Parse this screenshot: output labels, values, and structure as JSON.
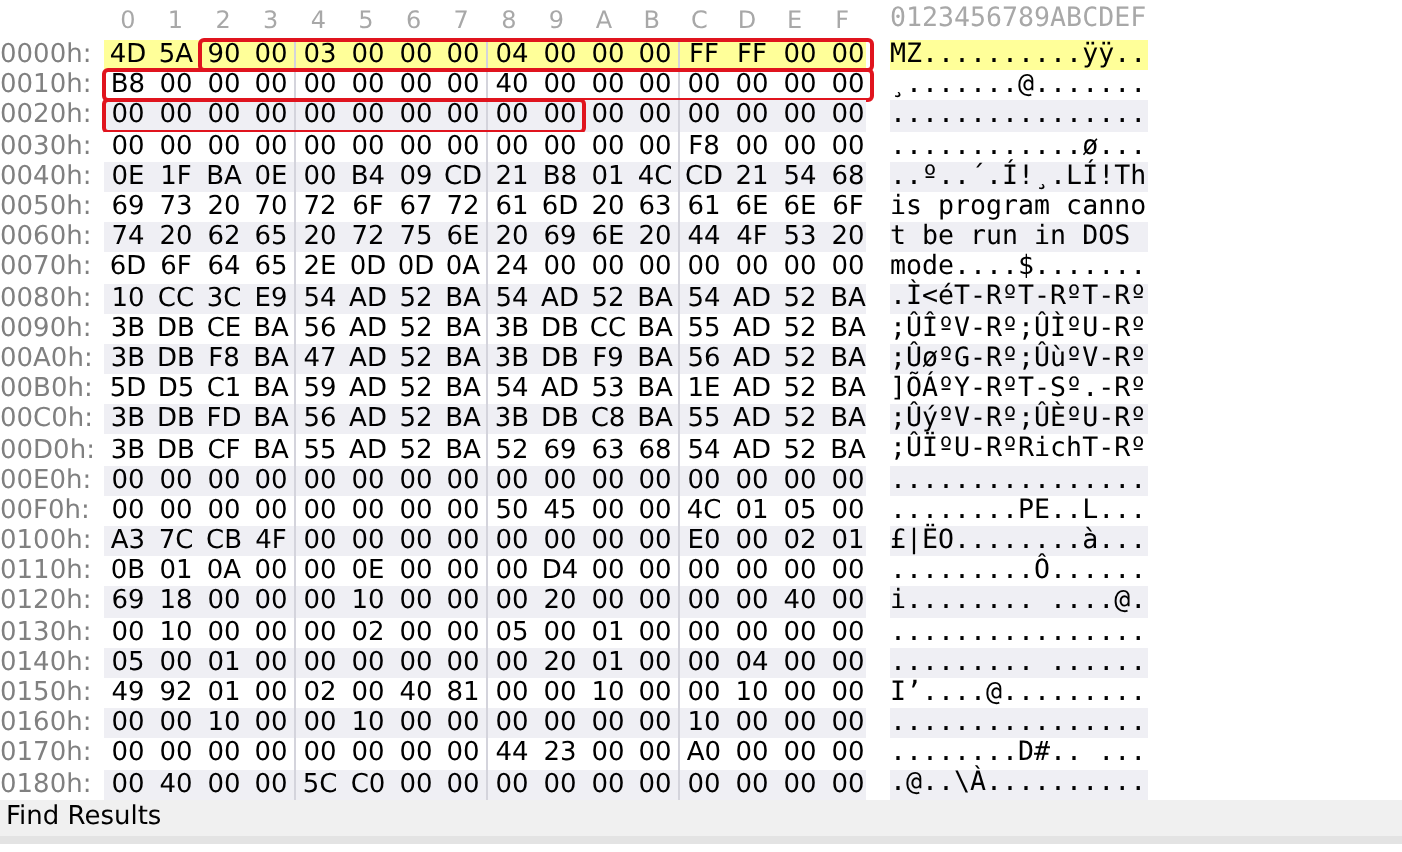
{
  "columns": [
    "0",
    "1",
    "2",
    "3",
    "4",
    "5",
    "6",
    "7",
    "8",
    "9",
    "A",
    "B",
    "C",
    "D",
    "E",
    "F"
  ],
  "ascii_header": "0123456789ABCDEF",
  "rows": [
    {
      "address": "0000h:",
      "selected": true,
      "segments": [
        {
          "outlined": false,
          "bytes": [
            "4D",
            "5A"
          ]
        },
        {
          "outlined": true,
          "bytes": [
            "90",
            "00",
            "03",
            "00",
            "00",
            "00",
            "04",
            "00",
            "00",
            "00",
            "FF",
            "FF",
            "00",
            "00"
          ]
        }
      ],
      "ascii": "MZ..........ÿÿ.."
    },
    {
      "address": "0010h:",
      "selected": false,
      "segments": [
        {
          "outlined": true,
          "bytes": [
            "B8",
            "00",
            "00",
            "00",
            "00",
            "00",
            "00",
            "00",
            "40",
            "00",
            "00",
            "00",
            "00",
            "00",
            "00",
            "00"
          ]
        }
      ],
      "ascii": "¸.......@......."
    },
    {
      "address": "0020h:",
      "selected": false,
      "segments": [
        {
          "outlined": true,
          "bytes": [
            "00",
            "00",
            "00",
            "00",
            "00",
            "00",
            "00",
            "00",
            "00",
            "00"
          ]
        },
        {
          "outlined": false,
          "bytes": [
            "00",
            "00",
            "00",
            "00",
            "00",
            "00"
          ]
        }
      ],
      "ascii": "................"
    },
    {
      "address": "0030h:",
      "selected": false,
      "segments": [
        {
          "outlined": false,
          "bytes": [
            "00",
            "00",
            "00",
            "00",
            "00",
            "00",
            "00",
            "00",
            "00",
            "00",
            "00",
            "00",
            "F8",
            "00",
            "00",
            "00"
          ]
        }
      ],
      "ascii": "............ø..."
    },
    {
      "address": "0040h:",
      "selected": false,
      "segments": [
        {
          "outlined": false,
          "bytes": [
            "0E",
            "1F",
            "BA",
            "0E",
            "00",
            "B4",
            "09",
            "CD",
            "21",
            "B8",
            "01",
            "4C",
            "CD",
            "21",
            "54",
            "68"
          ]
        }
      ],
      "ascii": "..º..´.Í!¸.LÍ!Th"
    },
    {
      "address": "0050h:",
      "selected": false,
      "segments": [
        {
          "outlined": false,
          "bytes": [
            "69",
            "73",
            "20",
            "70",
            "72",
            "6F",
            "67",
            "72",
            "61",
            "6D",
            "20",
            "63",
            "61",
            "6E",
            "6E",
            "6F"
          ]
        }
      ],
      "ascii": "is program canno"
    },
    {
      "address": "0060h:",
      "selected": false,
      "segments": [
        {
          "outlined": false,
          "bytes": [
            "74",
            "20",
            "62",
            "65",
            "20",
            "72",
            "75",
            "6E",
            "20",
            "69",
            "6E",
            "20",
            "44",
            "4F",
            "53",
            "20"
          ]
        }
      ],
      "ascii": "t be run in DOS "
    },
    {
      "address": "0070h:",
      "selected": false,
      "segments": [
        {
          "outlined": false,
          "bytes": [
            "6D",
            "6F",
            "64",
            "65",
            "2E",
            "0D",
            "0D",
            "0A",
            "24",
            "00",
            "00",
            "00",
            "00",
            "00",
            "00",
            "00"
          ]
        }
      ],
      "ascii": "mode....$......."
    },
    {
      "address": "0080h:",
      "selected": false,
      "segments": [
        {
          "outlined": false,
          "bytes": [
            "10",
            "CC",
            "3C",
            "E9",
            "54",
            "AD",
            "52",
            "BA",
            "54",
            "AD",
            "52",
            "BA",
            "54",
            "AD",
            "52",
            "BA"
          ]
        }
      ],
      "ascii": ".Ì<éT-RºT-RºT-Rº"
    },
    {
      "address": "0090h:",
      "selected": false,
      "segments": [
        {
          "outlined": false,
          "bytes": [
            "3B",
            "DB",
            "CE",
            "BA",
            "56",
            "AD",
            "52",
            "BA",
            "3B",
            "DB",
            "CC",
            "BA",
            "55",
            "AD",
            "52",
            "BA"
          ]
        }
      ],
      "ascii": ";ÛÎºV-Rº;ÛÌºU-Rº"
    },
    {
      "address": "00A0h:",
      "selected": false,
      "segments": [
        {
          "outlined": false,
          "bytes": [
            "3B",
            "DB",
            "F8",
            "BA",
            "47",
            "AD",
            "52",
            "BA",
            "3B",
            "DB",
            "F9",
            "BA",
            "56",
            "AD",
            "52",
            "BA"
          ]
        }
      ],
      "ascii": ";ÛøºG-Rº;ÛùºV-Rº"
    },
    {
      "address": "00B0h:",
      "selected": false,
      "segments": [
        {
          "outlined": false,
          "bytes": [
            "5D",
            "D5",
            "C1",
            "BA",
            "59",
            "AD",
            "52",
            "BA",
            "54",
            "AD",
            "53",
            "BA",
            "1E",
            "AD",
            "52",
            "BA"
          ]
        }
      ],
      "ascii": "]ÕÁºY-RºT-Sº.-Rº"
    },
    {
      "address": "00C0h:",
      "selected": false,
      "segments": [
        {
          "outlined": false,
          "bytes": [
            "3B",
            "DB",
            "FD",
            "BA",
            "56",
            "AD",
            "52",
            "BA",
            "3B",
            "DB",
            "C8",
            "BA",
            "55",
            "AD",
            "52",
            "BA"
          ]
        }
      ],
      "ascii": ";ÛýºV-Rº;ÛÈºU-Rº"
    },
    {
      "address": "00D0h:",
      "selected": false,
      "segments": [
        {
          "outlined": false,
          "bytes": [
            "3B",
            "DB",
            "CF",
            "BA",
            "55",
            "AD",
            "52",
            "BA",
            "52",
            "69",
            "63",
            "68",
            "54",
            "AD",
            "52",
            "BA"
          ]
        }
      ],
      "ascii": ";ÛÏºU-RºRichT-Rº"
    },
    {
      "address": "00E0h:",
      "selected": false,
      "segments": [
        {
          "outlined": false,
          "bytes": [
            "00",
            "00",
            "00",
            "00",
            "00",
            "00",
            "00",
            "00",
            "00",
            "00",
            "00",
            "00",
            "00",
            "00",
            "00",
            "00"
          ]
        }
      ],
      "ascii": "................"
    },
    {
      "address": "00F0h:",
      "selected": false,
      "segments": [
        {
          "outlined": false,
          "bytes": [
            "00",
            "00",
            "00",
            "00",
            "00",
            "00",
            "00",
            "00",
            "50",
            "45",
            "00",
            "00",
            "4C",
            "01",
            "05",
            "00"
          ]
        }
      ],
      "ascii": "........PE..L..."
    },
    {
      "address": "0100h:",
      "selected": false,
      "segments": [
        {
          "outlined": false,
          "bytes": [
            "A3",
            "7C",
            "CB",
            "4F",
            "00",
            "00",
            "00",
            "00",
            "00",
            "00",
            "00",
            "00",
            "E0",
            "00",
            "02",
            "01"
          ]
        }
      ],
      "ascii": "£|ËO........à..."
    },
    {
      "address": "0110h:",
      "selected": false,
      "segments": [
        {
          "outlined": false,
          "bytes": [
            "0B",
            "01",
            "0A",
            "00",
            "00",
            "0E",
            "00",
            "00",
            "00",
            "D4",
            "00",
            "00",
            "00",
            "00",
            "00",
            "00"
          ]
        }
      ],
      "ascii": ".........Ô......"
    },
    {
      "address": "0120h:",
      "selected": false,
      "segments": [
        {
          "outlined": false,
          "bytes": [
            "69",
            "18",
            "00",
            "00",
            "00",
            "10",
            "00",
            "00",
            "00",
            "20",
            "00",
            "00",
            "00",
            "00",
            "40",
            "00"
          ]
        }
      ],
      "ascii": "i........ ....@."
    },
    {
      "address": "0130h:",
      "selected": false,
      "segments": [
        {
          "outlined": false,
          "bytes": [
            "00",
            "10",
            "00",
            "00",
            "00",
            "02",
            "00",
            "00",
            "05",
            "00",
            "01",
            "00",
            "00",
            "00",
            "00",
            "00"
          ]
        }
      ],
      "ascii": "................"
    },
    {
      "address": "0140h:",
      "selected": false,
      "segments": [
        {
          "outlined": false,
          "bytes": [
            "05",
            "00",
            "01",
            "00",
            "00",
            "00",
            "00",
            "00",
            "00",
            "20",
            "01",
            "00",
            "00",
            "04",
            "00",
            "00"
          ]
        }
      ],
      "ascii": "......... ......"
    },
    {
      "address": "0150h:",
      "selected": false,
      "segments": [
        {
          "outlined": false,
          "bytes": [
            "49",
            "92",
            "01",
            "00",
            "02",
            "00",
            "40",
            "81",
            "00",
            "00",
            "10",
            "00",
            "00",
            "10",
            "00",
            "00"
          ]
        }
      ],
      "ascii": "I’....@........."
    },
    {
      "address": "0160h:",
      "selected": false,
      "segments": [
        {
          "outlined": false,
          "bytes": [
            "00",
            "00",
            "10",
            "00",
            "00",
            "10",
            "00",
            "00",
            "00",
            "00",
            "00",
            "00",
            "10",
            "00",
            "00",
            "00"
          ]
        }
      ],
      "ascii": "................"
    },
    {
      "address": "0170h:",
      "selected": false,
      "segments": [
        {
          "outlined": false,
          "bytes": [
            "00",
            "00",
            "00",
            "00",
            "00",
            "00",
            "00",
            "00",
            "44",
            "23",
            "00",
            "00",
            "A0",
            "00",
            "00",
            "00"
          ]
        }
      ],
      "ascii": "........D#.. ..."
    },
    {
      "address": "0180h:",
      "selected": false,
      "segments": [
        {
          "outlined": false,
          "bytes": [
            "00",
            "40",
            "00",
            "00",
            "5C",
            "C0",
            "00",
            "00",
            "00",
            "00",
            "00",
            "00",
            "00",
            "00",
            "00",
            "00"
          ]
        }
      ],
      "ascii": ".@..\\À.........."
    }
  ],
  "panel": {
    "title": "Find Results"
  }
}
